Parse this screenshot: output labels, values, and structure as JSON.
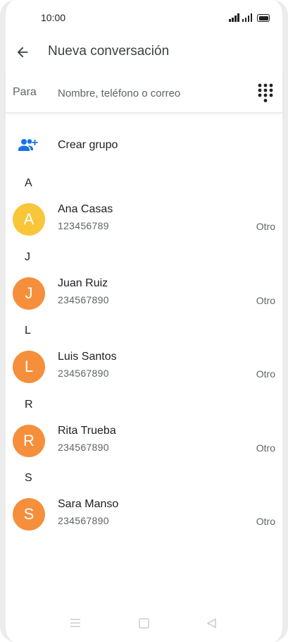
{
  "status_bar": {
    "time": "10:00"
  },
  "app_bar": {
    "title": "Nueva conversación"
  },
  "to_field": {
    "label": "Para",
    "placeholder": "Nombre, teléfono o correo",
    "value": ""
  },
  "create_group": {
    "label": "Crear grupo"
  },
  "sections": [
    {
      "letter": "A",
      "contacts": [
        {
          "initial": "A",
          "name": "Ana Casas",
          "phone": "123456789",
          "type": "Otro",
          "avatar_color": "#f9c63a"
        }
      ]
    },
    {
      "letter": "J",
      "contacts": [
        {
          "initial": "J",
          "name": "Juan Ruiz",
          "phone": "234567890",
          "type": "Otro",
          "avatar_color": "#f58f3b"
        }
      ]
    },
    {
      "letter": "L",
      "contacts": [
        {
          "initial": "L",
          "name": "Luis Santos",
          "phone": "234567890",
          "type": "Otro",
          "avatar_color": "#f58f3b"
        }
      ]
    },
    {
      "letter": "R",
      "contacts": [
        {
          "initial": "R",
          "name": "Rita Trueba",
          "phone": "234567890",
          "type": "Otro",
          "avatar_color": "#f58f3b"
        }
      ]
    },
    {
      "letter": "S",
      "contacts": [
        {
          "initial": "S",
          "name": "Sara Manso",
          "phone": "234567890",
          "type": "Otro",
          "avatar_color": "#f58f3b"
        }
      ]
    }
  ],
  "colors": {
    "accent": "#1a73e8",
    "avatar_yellow": "#f9c63a",
    "avatar_orange": "#f58f3b"
  },
  "icons": {
    "back": "arrow-back-icon",
    "dialpad": "dialpad-icon",
    "create_group": "group-add-icon",
    "nav_menu": "menu-icon",
    "nav_home": "home-icon",
    "nav_back": "back-triangle-icon"
  }
}
